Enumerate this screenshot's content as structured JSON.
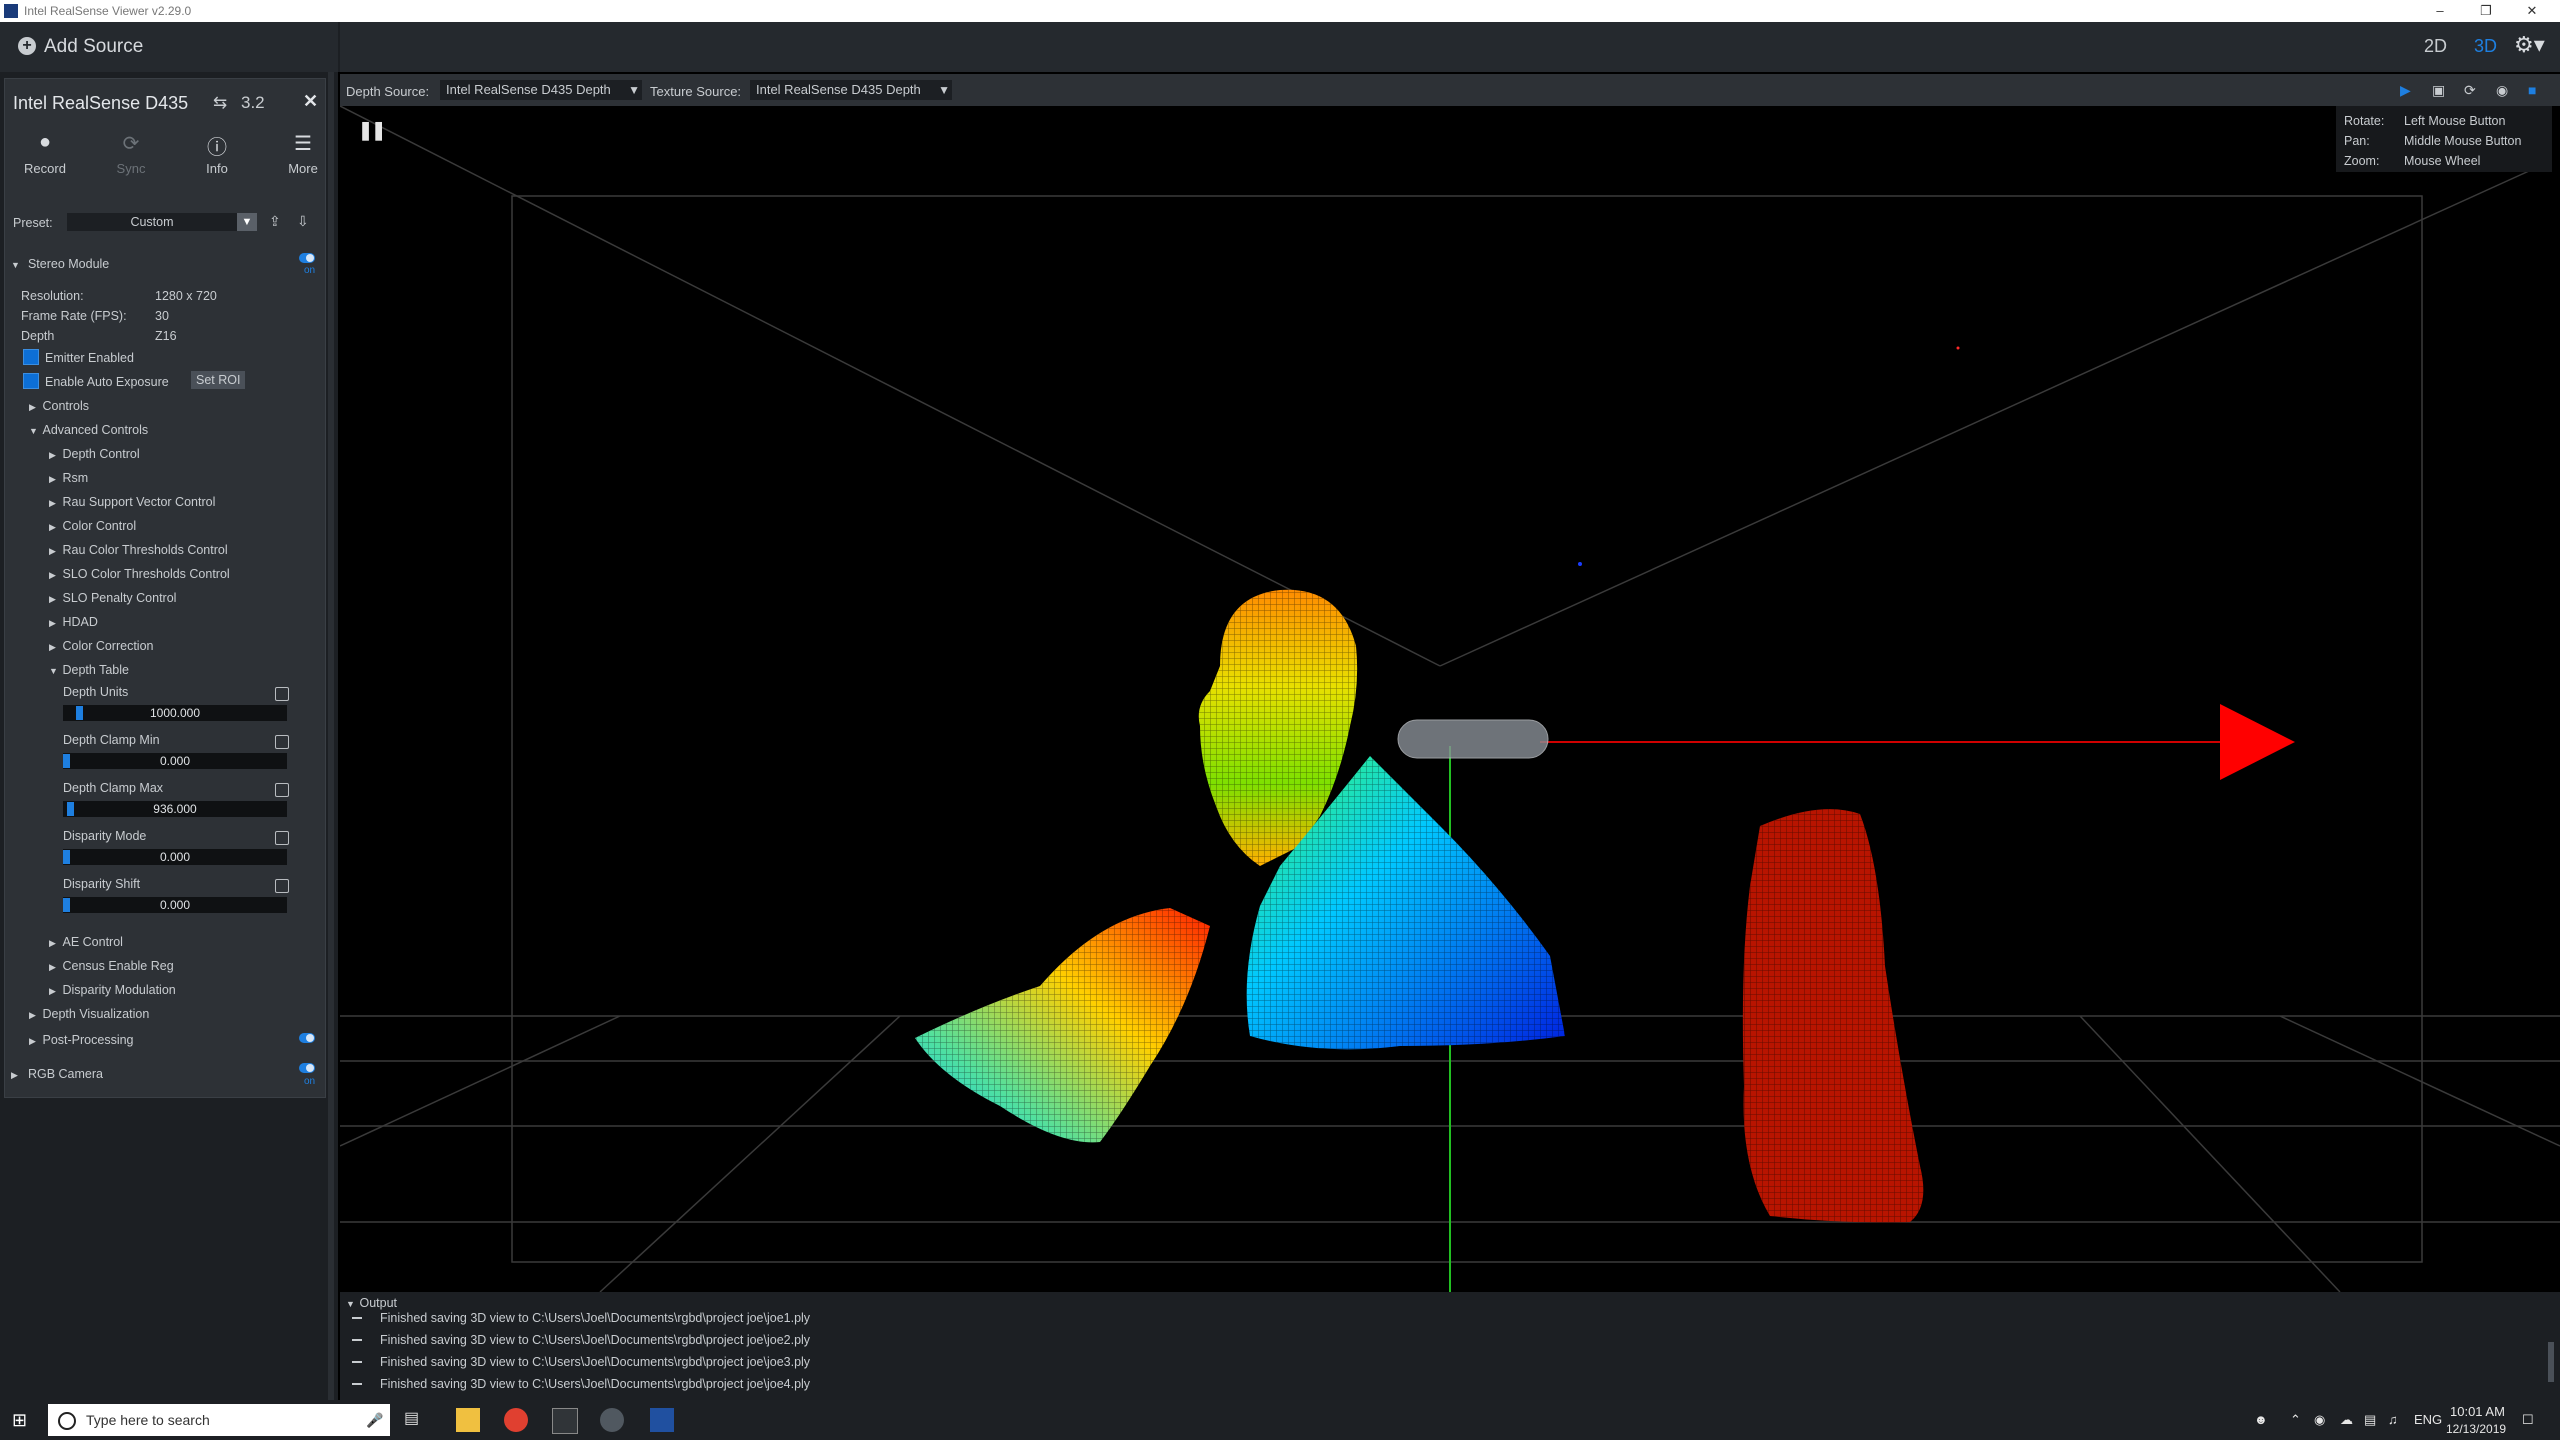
{
  "window": {
    "title": "Intel RealSense Viewer v2.29.0"
  },
  "topbar": {
    "add_source": "Add Source",
    "view_2d": "2D",
    "view_3d": "3D"
  },
  "device": {
    "name": "Intel RealSense D435",
    "usb": "3.2",
    "toolbar": [
      {
        "label": "Record",
        "icon": "record-icon"
      },
      {
        "label": "Sync",
        "icon": "sync-icon"
      },
      {
        "label": "Info",
        "icon": "info-icon"
      },
      {
        "label": "More",
        "icon": "menu-icon"
      }
    ],
    "preset_label": "Preset:",
    "preset_value": "Custom",
    "stereo_module": "Stereo Module",
    "toggle_on": "on",
    "resolution_label": "Resolution:",
    "resolution_value": "1280 x 720",
    "fps_label": "Frame Rate (FPS):",
    "fps_value": "30",
    "depth_label": "Depth",
    "depth_value": "Z16",
    "emitter": "Emitter Enabled",
    "auto_exposure": "Enable Auto Exposure",
    "set_roi": "Set ROI",
    "controls": "Controls",
    "advanced_controls": "Advanced Controls",
    "adv_items": [
      "Depth Control",
      "Rsm",
      "Rau Support Vector Control",
      "Color Control",
      "Rau Color Thresholds Control",
      "SLO Color Thresholds Control",
      "SLO Penalty Control",
      "HDAD",
      "Color Correction"
    ],
    "depth_table": "Depth Table",
    "sliders": [
      {
        "label": "Depth Units",
        "value": "1000.000",
        "level": 0.06
      },
      {
        "label": "Depth Clamp Min",
        "value": "0.000",
        "level": 0.0
      },
      {
        "label": "Depth Clamp Max",
        "value": "936.000",
        "level": 0.02
      },
      {
        "label": "Disparity Mode",
        "value": "0.000",
        "level": 0.0
      },
      {
        "label": "Disparity Shift",
        "value": "0.000",
        "level": 0.0
      }
    ],
    "adv_items_after": [
      "AE Control",
      "Census Enable Reg",
      "Disparity Modulation"
    ],
    "depth_visualization": "Depth Visualization",
    "post_processing": "Post-Processing",
    "rgb_camera": "RGB Camera"
  },
  "sourcebar": {
    "depth_label": "Depth Source:",
    "depth_value": "Intel RealSense D435 Depth",
    "texture_label": "Texture Source:",
    "texture_value": "Intel RealSense D435 Depth"
  },
  "controls_help": [
    {
      "k": "Rotate:",
      "v": "Left Mouse Button"
    },
    {
      "k": "Pan:",
      "v": "Middle Mouse Button"
    },
    {
      "k": "Zoom:",
      "v": "Mouse Wheel"
    }
  ],
  "output": {
    "header": "Output",
    "lines": [
      "Finished saving 3D view to C:\\Users\\Joel\\Documents\\rgbd\\project joe\\joe1.ply",
      "Finished saving 3D view to C:\\Users\\Joel\\Documents\\rgbd\\project joe\\joe2.ply",
      "Finished saving 3D view to C:\\Users\\Joel\\Documents\\rgbd\\project joe\\joe3.ply",
      "Finished saving 3D view to C:\\Users\\Joel\\Documents\\rgbd\\project joe\\joe4.ply"
    ]
  },
  "taskbar": {
    "search_placeholder": "Type here to search",
    "lang": "ENG",
    "time": "10:01 AM",
    "date": "12/13/2019"
  },
  "colors": {
    "accent": "#1e7fe0",
    "panel": "#2d3136",
    "background": "#1c1f23"
  }
}
